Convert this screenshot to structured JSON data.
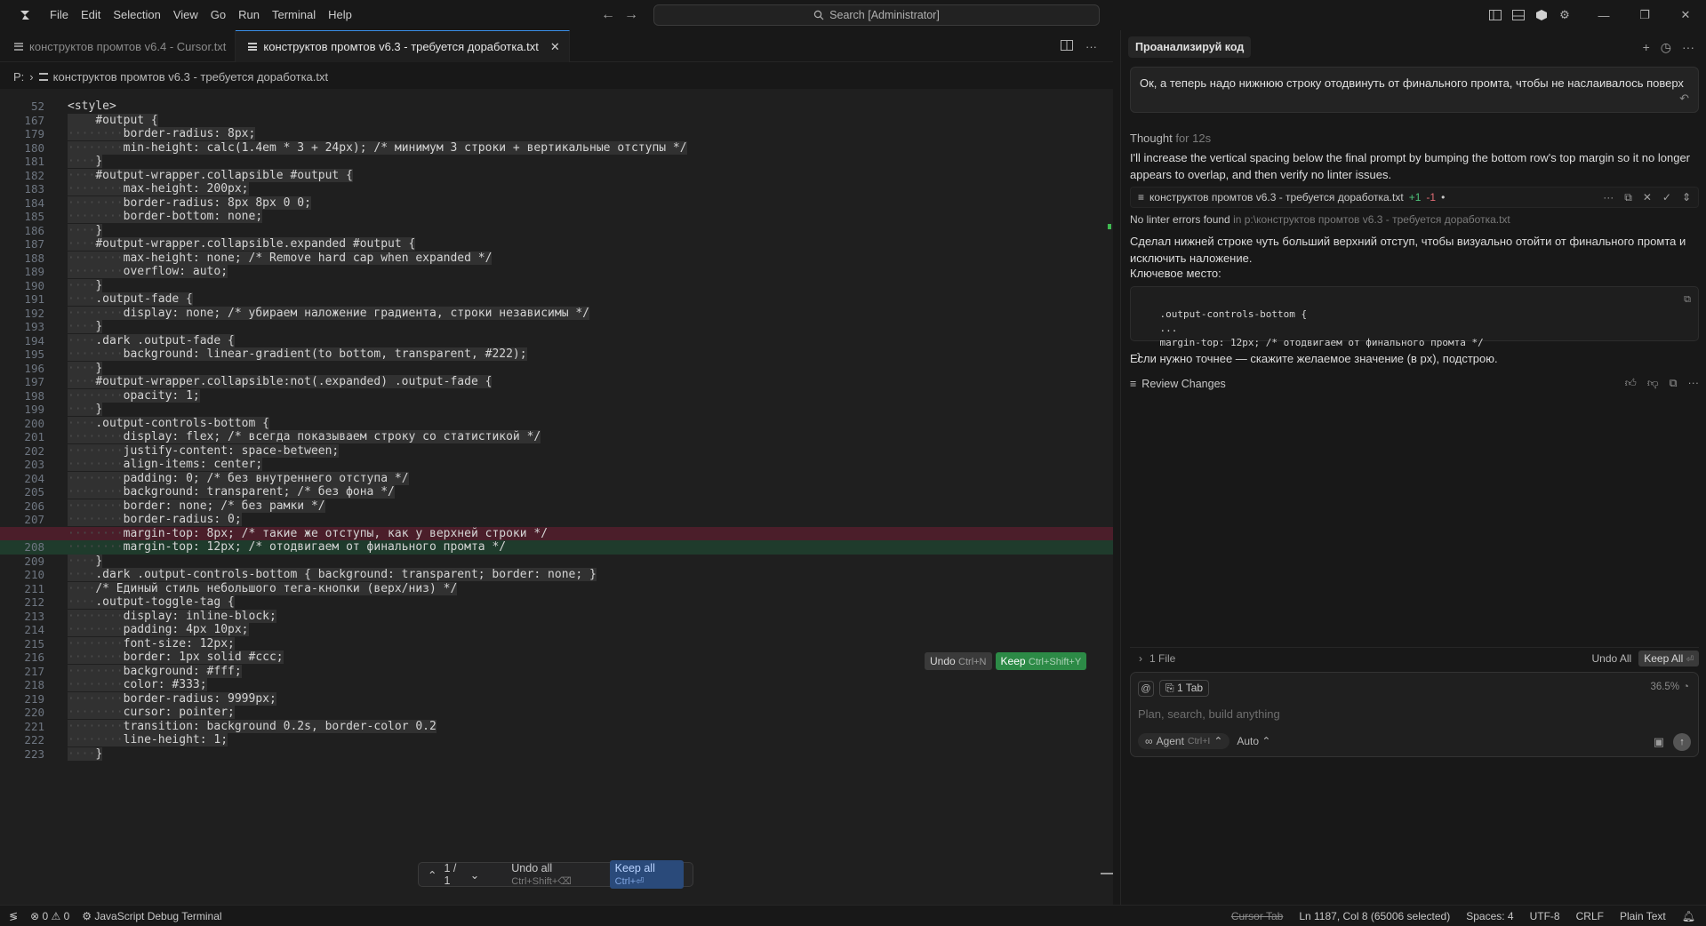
{
  "menu": [
    "File",
    "Edit",
    "Selection",
    "View",
    "Go",
    "Run",
    "Terminal",
    "Help"
  ],
  "search": {
    "label": "Search [Administrator]"
  },
  "tabs": [
    {
      "label": "конструктов промтов v6.4 - Cursor.txt",
      "active": false
    },
    {
      "label": "конструктов промтов v6.3 - требуется доработка.txt",
      "active": true
    }
  ],
  "breadcrumb": {
    "drive": "P:",
    "file": "конструктов промтов v6.3 - требуется доработка.txt"
  },
  "editor": {
    "lines": [
      {
        "n": "52",
        "code": "<style>",
        "indent": "",
        "type": "normal"
      },
      {
        "n": "167",
        "code": "#output {",
        "indent": "    ",
        "type": "normal"
      },
      {
        "n": "179",
        "code": "border-radius: 8px;",
        "indent": "········",
        "type": "normal"
      },
      {
        "n": "180",
        "code": "min-height: calc(1.4em * 3 + 24px); /* минимум 3 строки + вертикальные отступы */",
        "indent": "········",
        "type": "normal"
      },
      {
        "n": "181",
        "code": "}",
        "indent": "····",
        "type": "normal"
      },
      {
        "n": "182",
        "code": "#output-wrapper.collapsible #output {",
        "indent": "····",
        "type": "normal"
      },
      {
        "n": "183",
        "code": "max-height: 200px;",
        "indent": "········",
        "type": "normal"
      },
      {
        "n": "184",
        "code": "border-radius: 8px 8px 0 0;",
        "indent": "········",
        "type": "normal"
      },
      {
        "n": "185",
        "code": "border-bottom: none;",
        "indent": "········",
        "type": "normal"
      },
      {
        "n": "186",
        "code": "}",
        "indent": "····",
        "type": "normal"
      },
      {
        "n": "187",
        "code": "#output-wrapper.collapsible.expanded #output {",
        "indent": "····",
        "type": "normal"
      },
      {
        "n": "188",
        "code": "max-height: none; /* Remove hard cap when expanded */",
        "indent": "········",
        "type": "normal"
      },
      {
        "n": "189",
        "code": "overflow: auto;",
        "indent": "········",
        "type": "normal"
      },
      {
        "n": "190",
        "code": "}",
        "indent": "····",
        "type": "normal"
      },
      {
        "n": "191",
        "code": ".output-fade {",
        "indent": "····",
        "type": "normal"
      },
      {
        "n": "192",
        "code": "display: none; /* убираем наложение градиента, строки независимы */",
        "indent": "········",
        "type": "normal"
      },
      {
        "n": "193",
        "code": "}",
        "indent": "····",
        "type": "normal"
      },
      {
        "n": "194",
        "code": ".dark .output-fade {",
        "indent": "····",
        "type": "normal"
      },
      {
        "n": "195",
        "code": "background: linear-gradient(to bottom, transparent, #222);",
        "indent": "········",
        "type": "normal"
      },
      {
        "n": "196",
        "code": "}",
        "indent": "····",
        "type": "normal"
      },
      {
        "n": "197",
        "code": "#output-wrapper.collapsible:not(.expanded) .output-fade {",
        "indent": "····",
        "type": "normal"
      },
      {
        "n": "198",
        "code": "opacity: 1;",
        "indent": "········",
        "type": "normal"
      },
      {
        "n": "199",
        "code": "}",
        "indent": "····",
        "type": "normal"
      },
      {
        "n": "200",
        "code": ".output-controls-bottom {",
        "indent": "····",
        "type": "normal"
      },
      {
        "n": "201",
        "code": "display: flex; /* всегда показываем строку со статистикой */",
        "indent": "········",
        "type": "normal"
      },
      {
        "n": "202",
        "code": "justify-content: space-between;",
        "indent": "········",
        "type": "normal"
      },
      {
        "n": "203",
        "code": "align-items: center;",
        "indent": "········",
        "type": "normal"
      },
      {
        "n": "204",
        "code": "padding: 0; /* без внутреннего отступа */",
        "indent": "········",
        "type": "normal"
      },
      {
        "n": "205",
        "code": "background: transparent; /* без фона */",
        "indent": "········",
        "type": "normal"
      },
      {
        "n": "206",
        "code": "border: none; /* без рамки */",
        "indent": "········",
        "type": "normal"
      },
      {
        "n": "207",
        "code": "border-radius: 0;",
        "indent": "········",
        "type": "normal"
      },
      {
        "n": "",
        "code": "margin-top: 8px; /* такие же отступы, как у верхней строки */",
        "indent": "········",
        "type": "removed"
      },
      {
        "n": "208",
        "code": "margin-top: 12px; /* отодвигаем от финального промта */",
        "indent": "········",
        "type": "added"
      },
      {
        "n": "209",
        "code": "}",
        "indent": "····",
        "type": "normal"
      },
      {
        "n": "210",
        "code": ".dark .output-controls-bottom { background: transparent; border: none; }",
        "indent": "····",
        "type": "normal"
      },
      {
        "n": "211",
        "code": "/* Единый стиль небольшого тега-кнопки (верх/низ) */",
        "indent": "····",
        "type": "normal"
      },
      {
        "n": "212",
        "code": ".output-toggle-tag {",
        "indent": "····",
        "type": "normal"
      },
      {
        "n": "213",
        "code": "display: inline-block;",
        "indent": "········",
        "type": "normal"
      },
      {
        "n": "214",
        "code": "padding: 4px 10px;",
        "indent": "········",
        "type": "normal"
      },
      {
        "n": "215",
        "code": "font-size: 12px;",
        "indent": "········",
        "type": "normal"
      },
      {
        "n": "216",
        "code": "border: 1px solid #ccc;",
        "indent": "········",
        "type": "normal"
      },
      {
        "n": "217",
        "code": "background: #fff;",
        "indent": "········",
        "type": "normal"
      },
      {
        "n": "218",
        "code": "color: #333;",
        "indent": "········",
        "type": "normal"
      },
      {
        "n": "219",
        "code": "border-radius: 9999px;",
        "indent": "········",
        "type": "normal"
      },
      {
        "n": "220",
        "code": "cursor: pointer;",
        "indent": "········",
        "type": "normal"
      },
      {
        "n": "221",
        "code": "transition: background 0.2s, border-color 0.2",
        "indent": "········",
        "type": "normal"
      },
      {
        "n": "222",
        "code": "line-height: 1;",
        "indent": "········",
        "type": "normal"
      },
      {
        "n": "223",
        "code": "}",
        "indent": "····",
        "type": "normal"
      }
    ],
    "undo_label": "Undo",
    "undo_kbd": "Ctrl+N",
    "keep_label": "Keep",
    "keep_kbd": "Ctrl+Shift+Y",
    "diff_nav": {
      "count": "1 / 1",
      "undo_all": "Undo all",
      "undo_all_kbd": "Ctrl+Shift+⌫",
      "keep_all": "Keep all",
      "keep_all_kbd": "Ctrl+⏎"
    }
  },
  "chat": {
    "title": "Проанализируй код",
    "user_message": "Ок, а теперь надо нижнюю строку отодвинуть от финального промта, чтобы не наслаивалось поверх",
    "thought_label": "Thought",
    "thought_time": "for 12s",
    "reply1": "I'll increase the vertical spacing below the final prompt by bumping the bottom row's top margin so it no longer appears to overlap, and then verify no linter issues.",
    "file_chip": {
      "name": "конструктов промтов v6.3 - требуется доработка.txt",
      "plus": "+1",
      "minus": "-1",
      "dot": "•"
    },
    "lint_main": "No linter errors found",
    "lint_path": "in p:\\конструктов промтов v6.3 - требуется доработка.txt",
    "reply2": "Сделал нижней строке чуть больший верхний отступ, чтобы визуально отойти от финального промта и исключить наложение.",
    "key_place": "Ключевое место:",
    "code_snippet": ".output-controls-bottom {\n    ...\n    margin-top: 12px; /* отодвигаем от финального промта */\n}",
    "reply3": "Если нужно точнее — скажите желаемое значение (в px), подстрою.",
    "review_label": "Review Changes",
    "files_count": "1 File",
    "undo_all": "Undo All",
    "keep_all": "Keep All",
    "keep_all_kbd": "⏎",
    "context_chip": "1 Tab",
    "usage": "36.5%",
    "input_placeholder": "Plan, search, build anything",
    "agent_label": "Agent",
    "agent_kbd": "Ctrl+I",
    "model_label": "Auto"
  },
  "statusbar": {
    "errors": "0",
    "warnings": "0",
    "debug_terminal": "JavaScript Debug Terminal",
    "cursor_tab": "Cursor Tab",
    "position": "Ln 1187, Col 8 (65006 selected)",
    "spaces": "Spaces: 4",
    "encoding": "UTF-8",
    "eol": "CRLF",
    "language": "Plain Text"
  }
}
